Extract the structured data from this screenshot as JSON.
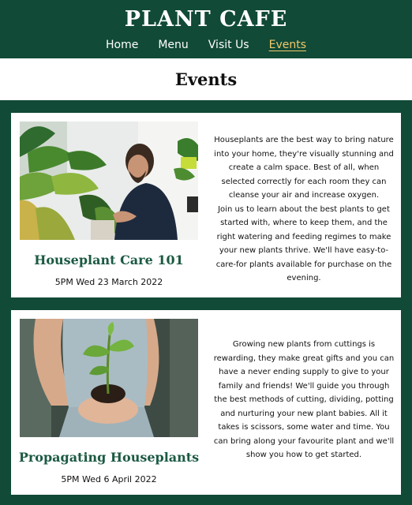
{
  "site": {
    "title": "PLANT CAFE"
  },
  "nav": {
    "items": [
      {
        "label": "Home"
      },
      {
        "label": "Menu"
      },
      {
        "label": "Visit Us"
      },
      {
        "label": "Events"
      }
    ],
    "active": "Events",
    "active_color": "#f3c86a"
  },
  "page": {
    "heading": "Events"
  },
  "colors": {
    "brand_green": "#114a37",
    "title_green": "#1b5a42"
  },
  "events": [
    {
      "title": "Houseplant Care 101",
      "date": "5PM Wed 23 March 2022",
      "image": "man-tending-houseplants-photo",
      "description": [
        "Houseplants are the best way to bring nature into your home, they're visually stunning and create a calm space. Best of all, when selected correctly for each room they can cleanse your air and increase oxygen.",
        "Join us to learn about the best plants to get started with, where to keep them, and the right watering and feeding regimes to make your new plants thrive. We'll have easy-to-care-for plants available for purchase on the evening."
      ]
    },
    {
      "title": "Propagating Houseplants",
      "date": "5PM Wed 6 April 2022",
      "image": "hands-holding-seedling-photo",
      "description": [
        "Growing new plants from cuttings is rewarding, they make great gifts and you can have a never ending supply to give to your family and friends! We'll guide you through the best methods of cutting, dividing, potting and nurturing your new plant babies. All it takes is scissors, some water and time. You can bring along your favourite plant and we'll show you how to get started."
      ]
    }
  ]
}
